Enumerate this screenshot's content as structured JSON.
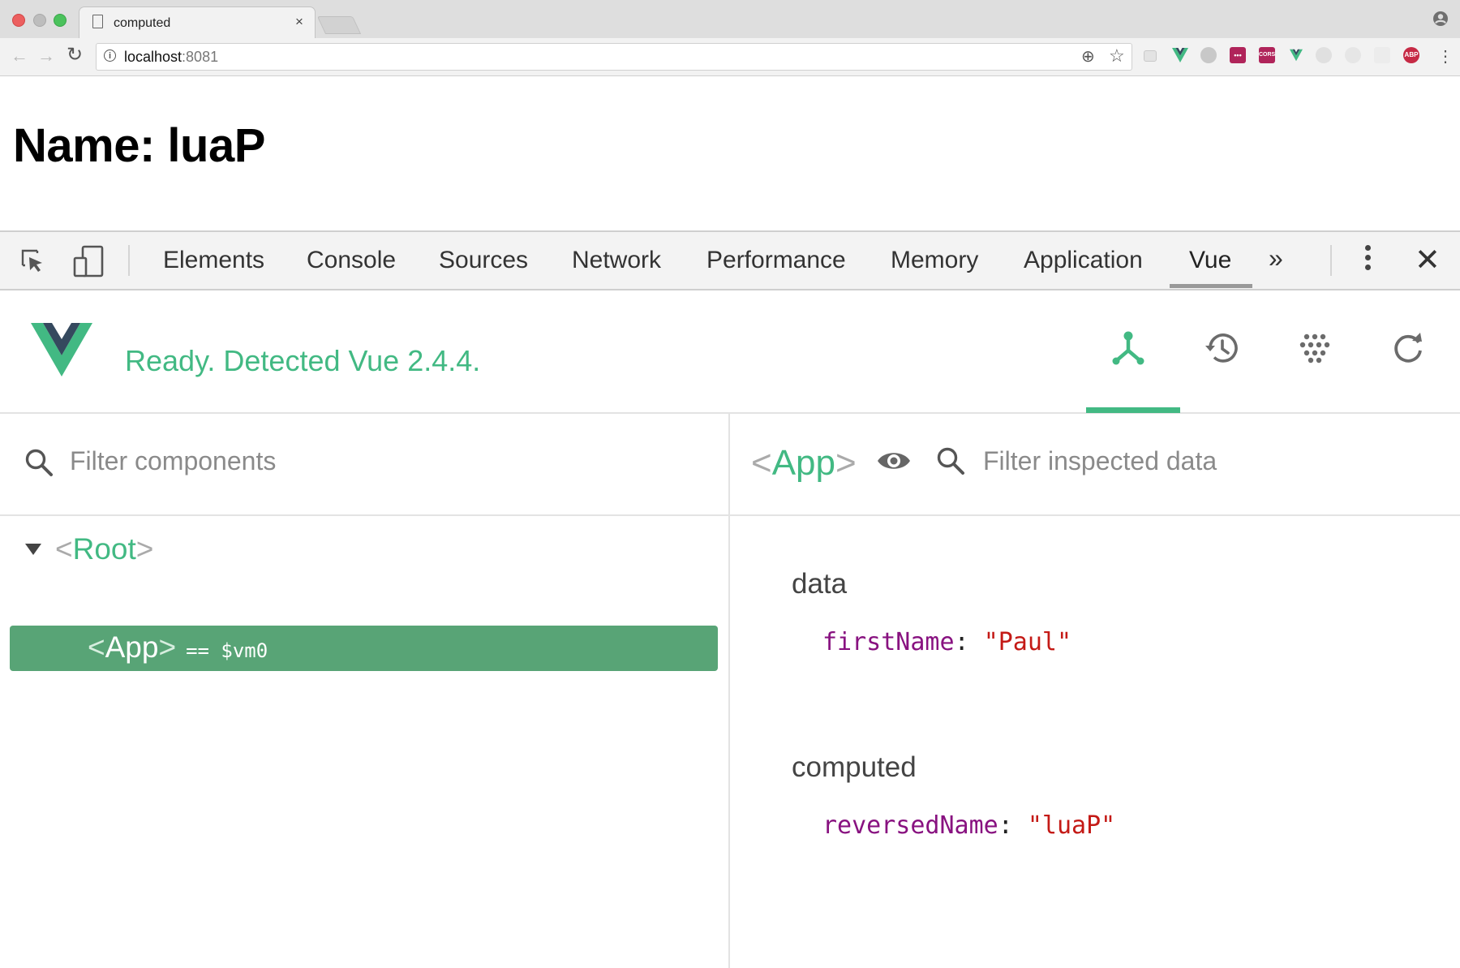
{
  "browser": {
    "tab_title": "computed",
    "tab_close": "×",
    "url_host": "localhost",
    "url_port": ":8081"
  },
  "page": {
    "heading": "Name: luaP"
  },
  "devtools": {
    "tabs": [
      "Elements",
      "Console",
      "Sources",
      "Network",
      "Performance",
      "Memory",
      "Application",
      "Vue"
    ],
    "active_tab": "Vue",
    "more": "»",
    "close": "✕"
  },
  "vue": {
    "status": "Ready. Detected Vue 2.4.4.",
    "accent_color": "#42b983",
    "toolbar_icons": [
      "components-icon",
      "history-icon",
      "vuex-icon",
      "refresh-icon"
    ],
    "components": {
      "filter_placeholder": "Filter components",
      "tree": [
        {
          "open": "<",
          "name": "Root",
          "close": ">",
          "expanded": true
        },
        {
          "open": "<",
          "name": "App",
          "close": ">",
          "ref": "== $vm0",
          "selected": true
        }
      ]
    },
    "inspector": {
      "component_open": "<",
      "component_name": "App",
      "component_close": ">",
      "filter_placeholder": "Filter inspected data",
      "sections": [
        {
          "title": "data",
          "entries": [
            {
              "key": "firstName",
              "colon": ":",
              "value": "\"Paul\""
            }
          ]
        },
        {
          "title": "computed",
          "entries": [
            {
              "key": "reversedName",
              "colon": ":",
              "value": "\"luaP\""
            }
          ]
        }
      ]
    }
  }
}
